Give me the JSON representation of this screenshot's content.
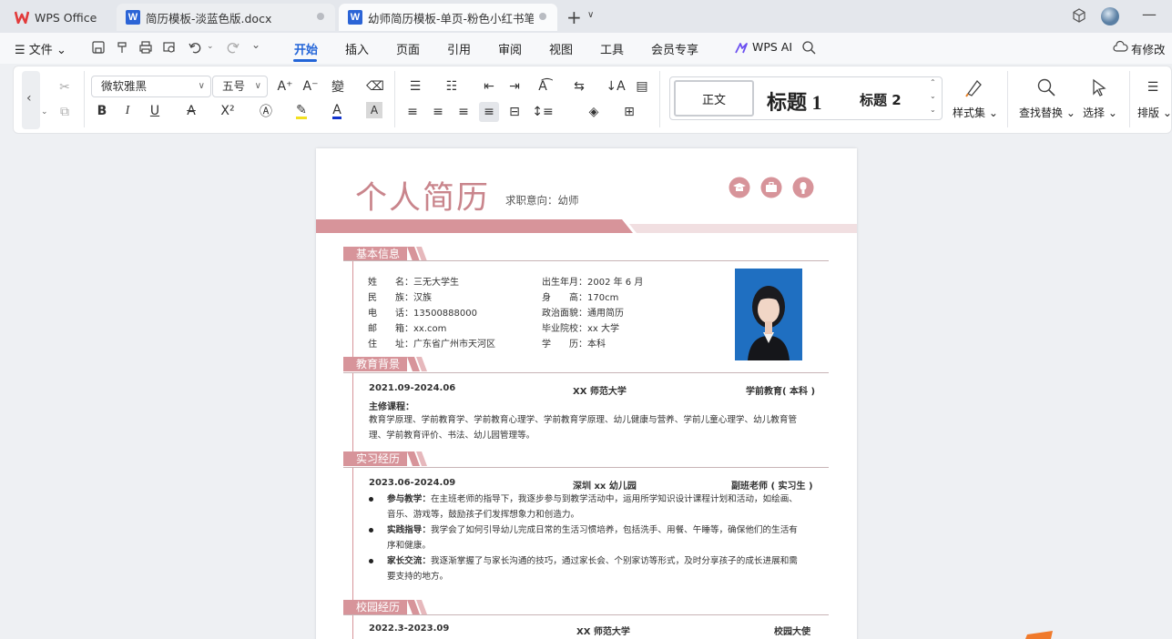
{
  "tabs": [
    {
      "label": "WPS Office"
    },
    {
      "label": "简历模板-淡蓝色版.docx"
    },
    {
      "label": "幼师简历模板-单页-粉色小红书笔记"
    }
  ],
  "menu": {
    "file": "文件",
    "items": [
      "开始",
      "插入",
      "页面",
      "引用",
      "审阅",
      "视图",
      "工具",
      "会员专享"
    ],
    "wps_ai": "WPS AI",
    "modify": "有修改"
  },
  "ribbon": {
    "font_name": "微软雅黑",
    "font_size": "五号",
    "styles": {
      "normal": "正文",
      "h1": "标题 1",
      "h2": "标题 2"
    },
    "style_set": "样式集",
    "find_replace": "查找替换",
    "select": "选择",
    "layout": "排版"
  },
  "resume": {
    "title": "个人简历",
    "objective": "求职意向：幼师",
    "sections": {
      "basic": "基本信息",
      "edu": "教育背景",
      "intern": "实习经历",
      "campus": "校园经历"
    },
    "basic_left": [
      {
        "label": "姓　　名：",
        "value": "三无大学生"
      },
      {
        "label": "民　　族：",
        "value": "汉族"
      },
      {
        "label": "电　　话：",
        "value": "13500888000"
      },
      {
        "label": "邮　　箱：",
        "value": "xx.com"
      },
      {
        "label": "住　　址：",
        "value": "广东省广州市天河区"
      }
    ],
    "basic_right": [
      {
        "label": "出生年月：",
        "value": "2002 年 6 月"
      },
      {
        "label": "身　　高：",
        "value": "170cm"
      },
      {
        "label": "政治面貌：",
        "value": "通用简历"
      },
      {
        "label": "毕业院校：",
        "value": "xx 大学"
      },
      {
        "label": "学　　历：",
        "value": "本科"
      }
    ],
    "edu": {
      "date": "2021.09-2024.06",
      "school": "XX 师范大学",
      "major": "学前教育( 本科 )",
      "courses_label": "主修课程：",
      "courses_line1": "教育学原理、学前教育学、学前教育心理学、学前教育学原理、幼儿健康与营养、学前儿童心理学、幼儿教育管",
      "courses_line2": "理、学前教育评价、书法、幼儿园管理等。"
    },
    "intern": {
      "date": "2023.06-2024.09",
      "org": "深圳 xx 幼儿园",
      "role": "副班老师 ( 实习生 )",
      "bullets": [
        {
          "head": "参与教学：",
          "line1": "在主班老师的指导下，我逐步参与到教学活动中，运用所学知识设计课程计划和活动，如绘画、",
          "line2": "音乐、游戏等，鼓励孩子们发挥想象力和创造力。"
        },
        {
          "head": "实践指导：",
          "line1": "我学会了如何引导幼儿完成日常的生活习惯培养，包括洗手、用餐、午睡等，确保他们的生活有",
          "line2": "序和健康。"
        },
        {
          "head": "家长交流：",
          "line1": "我逐渐掌握了与家长沟通的技巧，通过家长会、个别家访等形式，及时分享孩子的成长进展和需",
          "line2": "要支持的地方。"
        }
      ]
    },
    "campus": {
      "date": "2022.3-2023.09",
      "school": "XX 师范大学",
      "role": "校园大使"
    }
  },
  "colors": {
    "accent": "#2365d8",
    "resume_pink": "#d7949a",
    "title_pink": "#c9858c"
  }
}
